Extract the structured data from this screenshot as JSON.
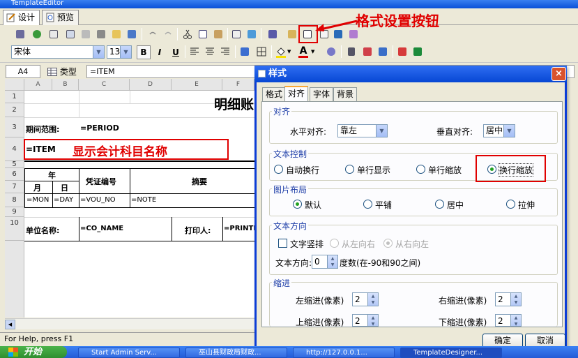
{
  "window": {
    "title": "TemplateEditor"
  },
  "tabs": [
    {
      "label": "设计"
    },
    {
      "label": "预览"
    }
  ],
  "annotations": {
    "format_button_callout": "格式设置按钮",
    "item_callout": "显示会计科目名称"
  },
  "format_toolbar": {
    "font_name": "宋体",
    "font_size": "13",
    "bold_label": "B",
    "italic_label": "I",
    "underline_label": "U",
    "font_color_label": "A"
  },
  "cell_bar": {
    "cell_ref": "A4",
    "type_label": "类型",
    "formula": "=ITEM"
  },
  "sheet": {
    "columns": [
      "A",
      "B",
      "C",
      "D",
      "E",
      "F"
    ],
    "rows": [
      "1",
      "2",
      "3",
      "4",
      "5",
      "6",
      "7",
      "8",
      "9",
      "10"
    ],
    "title": "明细账",
    "period_label": "期间范围:",
    "period_value": "=PERIOD",
    "item_value": "=ITEM",
    "year_header": "年",
    "month_header": "月",
    "day_header": "日",
    "voucher_header": "凭证编号",
    "summary_header": "摘要",
    "mon_value": "=MON",
    "day_value": "=DAY",
    "vou_value": "=VOU_NO",
    "note_value": "=NOTE",
    "unit_label": "单位名称:",
    "unit_value": "=CO_NAME",
    "printer_label": "打印人:",
    "printer_value": "=PRINTER"
  },
  "status_text": "For Help, press F1",
  "dialog": {
    "title": "样式",
    "close_label": "×",
    "tabs": [
      "格式",
      "对齐",
      "字体",
      "背景"
    ],
    "align": {
      "group_label": "对齐",
      "h_label": "水平对齐:",
      "h_value": "靠左",
      "v_label": "垂直对齐:",
      "v_value": "居中"
    },
    "text_control": {
      "group_label": "文本控制",
      "options": [
        "自动换行",
        "单行显示",
        "单行缩放",
        "换行缩放"
      ],
      "selected": "换行缩放"
    },
    "image_layout": {
      "group_label": "图片布局",
      "options": [
        "默认",
        "平铺",
        "居中",
        "拉伸"
      ],
      "selected": "默认"
    },
    "text_direction": {
      "group_label": "文本方向",
      "vertical_label": "文字竖排",
      "ltr_label": "从左向右",
      "rtl_label": "从右向左",
      "dir_label": "文本方向:",
      "dir_value": "0",
      "dir_hint": "度数(在-90和90之间)"
    },
    "indent": {
      "group_label": "缩进",
      "left_label": "左缩进(像素)",
      "left_value": "2",
      "right_label": "右缩进(像素)",
      "right_value": "2",
      "top_label": "上缩进(像素)",
      "top_value": "2",
      "bottom_label": "下缩进(像素)",
      "bottom_value": "2"
    },
    "ok_label": "确定",
    "cancel_label": "取消"
  },
  "taskbar": {
    "start_label": "开始",
    "tasks": [
      "Start Admin Serv...",
      "巫山县财政局财政...",
      "http://127.0.0.1...",
      "TemplateDesigner..."
    ]
  },
  "colors": {
    "accent": "#0c3dd6",
    "annotation": "#e00000"
  }
}
